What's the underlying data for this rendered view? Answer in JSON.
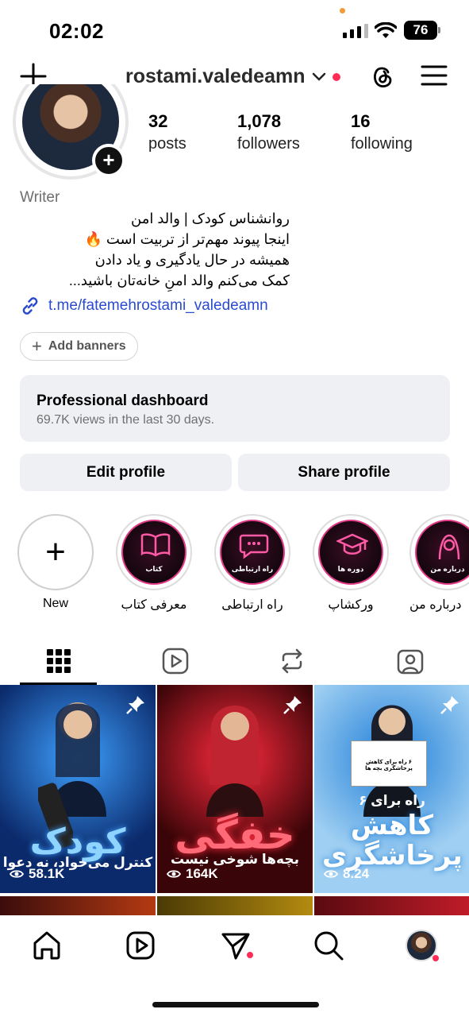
{
  "status_bar": {
    "time": "02:02",
    "battery": "76",
    "recording_dot_color": "#f29c38"
  },
  "header": {
    "username": "rostami.valedeamn",
    "has_notification_dot": true,
    "icons": [
      "plus-icon",
      "chevron-down-icon",
      "threads-icon",
      "hamburger-menu-icon"
    ]
  },
  "profile": {
    "stats": [
      {
        "number": "32",
        "label": "posts"
      },
      {
        "number": "1,078",
        "label": "followers"
      },
      {
        "number": "16",
        "label": "following"
      }
    ],
    "category": "Writer",
    "bio_lines": [
      "روانشناس کودک | والد امن",
      "اینجا پیوند مهم‌تر از تربیت است 🔥",
      "همیشه در حال یادگیری و یاد دادن",
      "کمک می‌کنم والد امنِ خانه‌تان باشید..."
    ],
    "link": "t.me/fatemehrostami_valedeamn",
    "add_banners": "Add banners"
  },
  "dashboard": {
    "title": "Professional dashboard",
    "subtitle": "69.7K views in the last 30 days."
  },
  "actions": {
    "edit": "Edit profile",
    "share": "Share profile"
  },
  "highlights": [
    {
      "name": "New",
      "caption": ""
    },
    {
      "name": "معرفی کتاب",
      "caption": "کتاب"
    },
    {
      "name": "راه ارتباطی",
      "caption": "راه ارتباطی"
    },
    {
      "name": "ورکشاپ",
      "caption": "دوره ها"
    },
    {
      "name": "درباره من",
      "caption": "درباره من"
    }
  ],
  "tabs": [
    "grid-tab",
    "reels-tab",
    "reposts-tab",
    "tagged-tab"
  ],
  "posts": [
    {
      "headline": "کودک",
      "subline": "کنترل می‌خواد، نه دعوا",
      "views": "58.1K",
      "pinned": true,
      "bg": "#0b2a6b",
      "accent": "#3ea0ff"
    },
    {
      "headline": "خفگی",
      "subline": "بچه‌ها شوخی نیست",
      "views": "164K",
      "pinned": true,
      "bg": "#3a0508",
      "accent": "#ff2a3d"
    },
    {
      "headline": "کاهش پرخاشگری",
      "subline": "۶ راه برای",
      "sign": "۶ راه برای کاهش پرخاشگری بچه ها",
      "views": "8.24",
      "pinned": true,
      "bg": "#9fcff2",
      "accent": "#1f7ed8"
    }
  ],
  "bottom_nav": [
    "home-icon",
    "reels-icon",
    "direct-icon",
    "search-icon",
    "profile-avatar"
  ]
}
